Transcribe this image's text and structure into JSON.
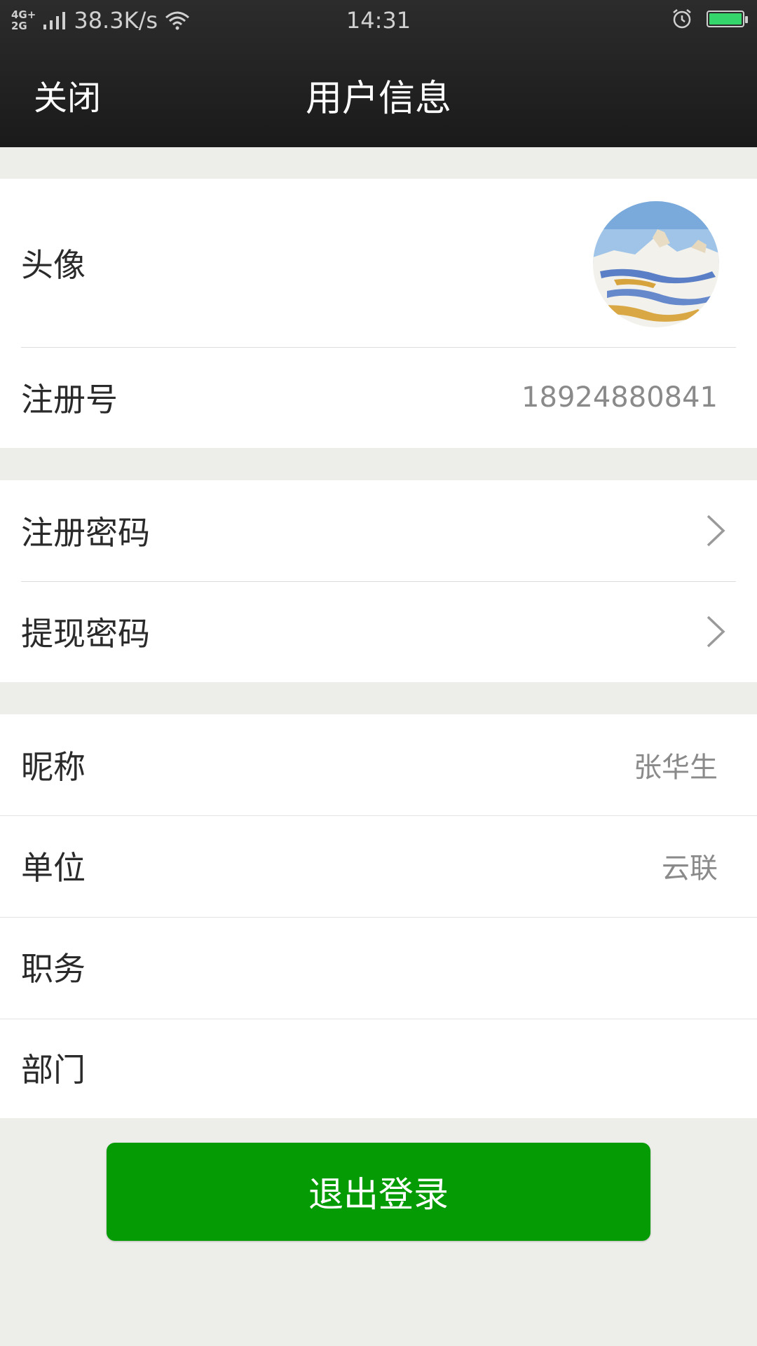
{
  "status_bar": {
    "network": [
      "4G+",
      "2G"
    ],
    "speed": "38.3K/s",
    "time": "14:31",
    "battery_level": 1.0,
    "battery_color": "#34d66b"
  },
  "nav": {
    "close_label": "关闭",
    "title": "用户信息"
  },
  "profile": {
    "avatar_label": "头像",
    "reg_number_label": "注册号",
    "reg_number_value": "18924880841"
  },
  "security": {
    "reg_password_label": "注册密码",
    "withdraw_password_label": "提现密码"
  },
  "details": {
    "nickname_label": "昵称",
    "nickname_value": "张华生",
    "unit_label": "单位",
    "unit_value": "云联",
    "position_label": "职务",
    "position_value": "",
    "department_label": "部门",
    "department_value": ""
  },
  "logout_label": "退出登录",
  "colors": {
    "header": "#1f1f1f",
    "background": "#ededea",
    "logout_button": "#049b04"
  }
}
